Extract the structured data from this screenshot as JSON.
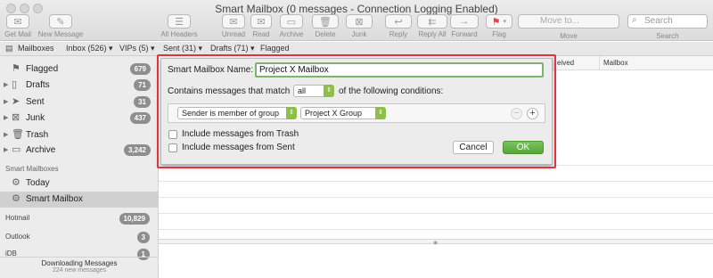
{
  "window": {
    "title": "Smart Mailbox (0 messages - Connection Logging Enabled)"
  },
  "toolbar": {
    "get_mail": "Get Mail",
    "new_message": "New Message",
    "all_headers": "All Headers",
    "unread": "Unread",
    "read": "Read",
    "archive": "Archive",
    "delete": "Delete",
    "junk": "Junk",
    "reply": "Reply",
    "reply_all": "Reply All",
    "forward": "Forward",
    "flag": "Flag",
    "move_placeholder": "Move to...",
    "move_label": "Move",
    "search_placeholder": "Search",
    "search_label": "Search"
  },
  "favorites": {
    "mailboxes": "Mailboxes",
    "inbox": "Inbox (526)",
    "vips": "VIPs (5)",
    "sent": "Sent (31)",
    "drafts": "Drafts (71)",
    "flagged": "Flagged"
  },
  "sidebar": {
    "items": [
      {
        "label": "Flagged",
        "count": "679"
      },
      {
        "label": "Drafts",
        "count": "71"
      },
      {
        "label": "Sent",
        "count": "31"
      },
      {
        "label": "Junk",
        "count": "437"
      },
      {
        "label": "Trash",
        "count": ""
      },
      {
        "label": "Archive",
        "count": "3,242"
      }
    ],
    "smart_section": "Smart Mailboxes",
    "smart_items": [
      {
        "label": "Today"
      },
      {
        "label": "Smart Mailbox"
      }
    ],
    "accounts": [
      {
        "label": "Hotmail",
        "count": "10,829"
      },
      {
        "label": "Outlook",
        "count": "3"
      },
      {
        "label": "iDB",
        "count": "1"
      }
    ],
    "status": "Downloading Messages",
    "status_sub": "224 new messages"
  },
  "message_list": {
    "columns": {
      "received": "eived",
      "mailbox": "Mailbox"
    }
  },
  "dialog": {
    "name_label": "Smart Mailbox Name:",
    "name_value": "Project X Mailbox",
    "match_prefix": "Contains messages that match",
    "match_value": "all",
    "match_suffix": "of the following conditions:",
    "condition_field": "Sender is member of group",
    "condition_value": "Project X Group",
    "include_trash": "Include messages from Trash",
    "include_sent": "Include messages from Sent",
    "cancel": "Cancel",
    "ok": "OK",
    "highlight_color": "#e0333b",
    "ok_color": "#5aa83c"
  }
}
